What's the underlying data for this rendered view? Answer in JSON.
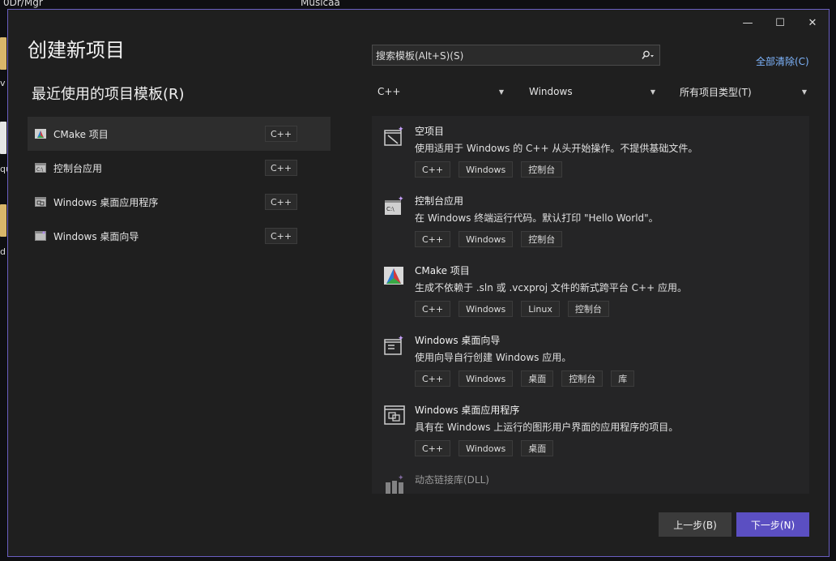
{
  "desktop": {
    "top_left_label": "0Dr/Mgr",
    "top_center_label": "Musicaa",
    "side_text_1": "v",
    "side_text_2": "qu",
    "side_text_3": "d"
  },
  "window": {
    "title": "创建新项目",
    "controls": {
      "minimize": "—",
      "maximize": "☐",
      "close": "✕"
    }
  },
  "recent": {
    "heading": "最近使用的项目模板(R)",
    "items": [
      {
        "label": "CMake 项目",
        "tag": "C++",
        "icon": "cmake-icon"
      },
      {
        "label": "控制台应用",
        "tag": "C++",
        "icon": "console-icon"
      },
      {
        "label": "Windows 桌面应用程序",
        "tag": "C++",
        "icon": "desktop-app-icon"
      },
      {
        "label": "Windows 桌面向导",
        "tag": "C++",
        "icon": "wizard-icon"
      }
    ]
  },
  "search": {
    "placeholder": "搜索模板(Alt+S)(S)",
    "button_icon": "search-icon"
  },
  "clear_all": "全部清除(C)",
  "filters": {
    "language": "C++",
    "platform": "Windows",
    "project_type": "所有项目类型(T)"
  },
  "templates": [
    {
      "name": "空项目",
      "desc": "使用适用于 Windows 的 C++ 从头开始操作。不提供基础文件。",
      "tags": [
        "C++",
        "Windows",
        "控制台"
      ],
      "icon": "empty-project-icon"
    },
    {
      "name": "控制台应用",
      "desc": "在 Windows 终端运行代码。默认打印 \"Hello World\"。",
      "tags": [
        "C++",
        "Windows",
        "控制台"
      ],
      "icon": "console-icon"
    },
    {
      "name": "CMake 项目",
      "desc": "生成不依赖于 .sln 或 .vcxproj 文件的新式跨平台 C++ 应用。",
      "tags": [
        "C++",
        "Windows",
        "Linux",
        "控制台"
      ],
      "icon": "cmake-icon"
    },
    {
      "name": "Windows 桌面向导",
      "desc": "使用向导自行创建 Windows 应用。",
      "tags": [
        "C++",
        "Windows",
        "桌面",
        "控制台",
        "库"
      ],
      "icon": "wizard-icon"
    },
    {
      "name": "Windows 桌面应用程序",
      "desc": "具有在 Windows 上运行的图形用户界面的应用程序的项目。",
      "tags": [
        "C++",
        "Windows",
        "桌面"
      ],
      "icon": "desktop-app-icon"
    },
    {
      "name": "动态链接库(DLL)",
      "desc": "",
      "tags": [],
      "icon": "dll-icon"
    }
  ],
  "buttons": {
    "back": "上一步(B)",
    "next": "下一步(N)"
  },
  "colors": {
    "accent": "#5b4fc2",
    "link": "#7fb6ff",
    "border": "#6a5fc1"
  }
}
